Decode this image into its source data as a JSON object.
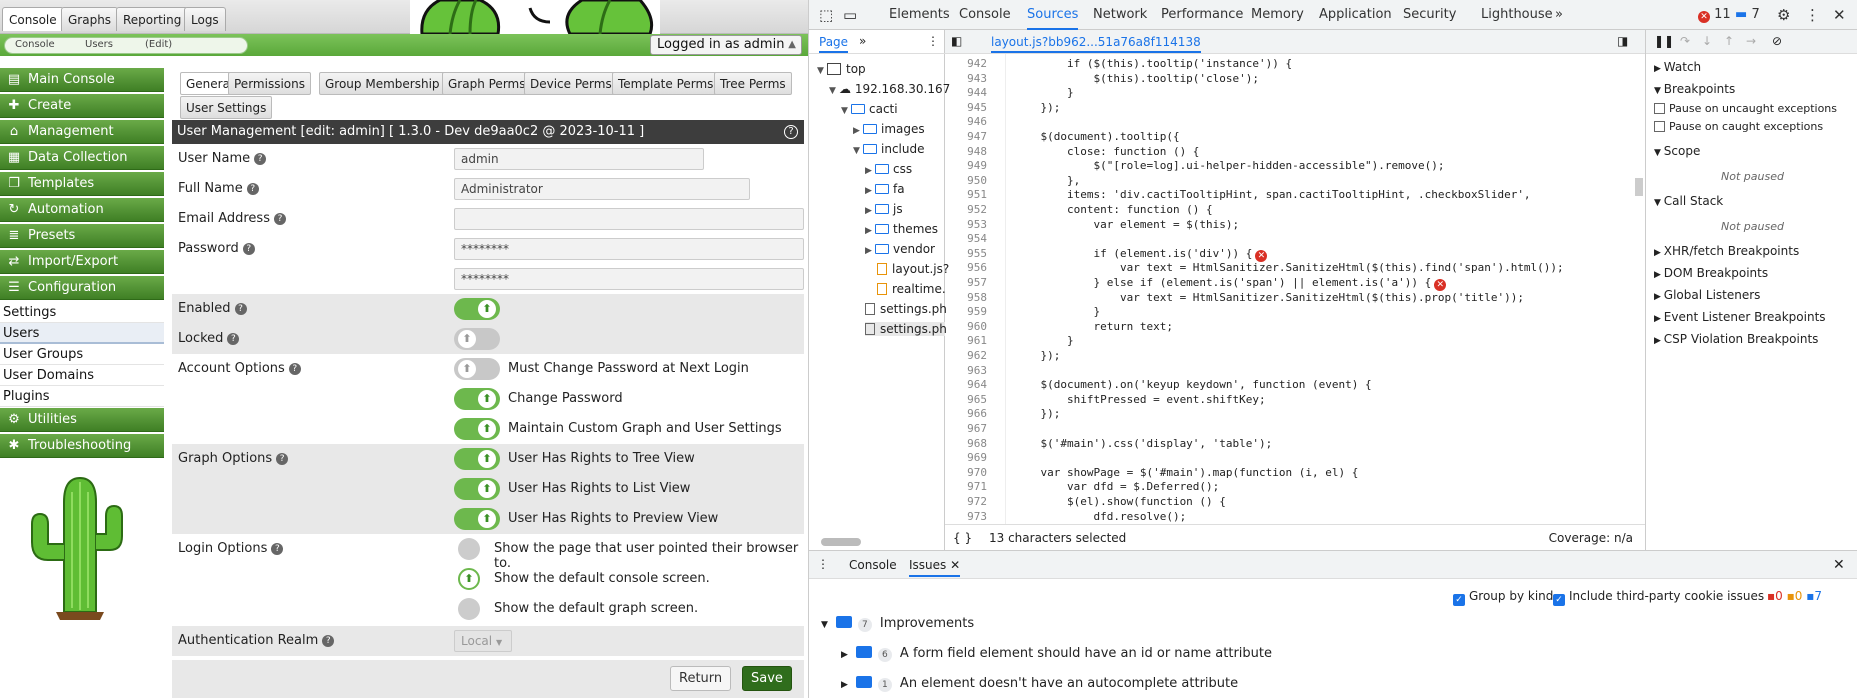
{
  "top_tabs": [
    "Console",
    "Graphs",
    "Reporting",
    "Logs"
  ],
  "breadcrumbs": [
    "Console",
    "Users",
    "(Edit)"
  ],
  "login_status": "Logged in as admin",
  "sidebar": {
    "menu": [
      {
        "label": "Main Console",
        "icon": "map-icon"
      },
      {
        "label": "Create",
        "icon": "plus-icon"
      },
      {
        "label": "Management",
        "icon": "home-icon"
      },
      {
        "label": "Data Collection",
        "icon": "database-icon"
      },
      {
        "label": "Templates",
        "icon": "clone-icon"
      },
      {
        "label": "Automation",
        "icon": "refresh-icon"
      },
      {
        "label": "Presets",
        "icon": "stack-icon"
      },
      {
        "label": "Import/Export",
        "icon": "exchange-icon"
      },
      {
        "label": "Configuration",
        "icon": "sliders-icon"
      }
    ],
    "sub_items": [
      "Settings",
      "Users",
      "User Groups",
      "User Domains",
      "Plugins"
    ],
    "menu_bottom": [
      {
        "label": "Utilities",
        "icon": "cogs-icon"
      },
      {
        "label": "Troubleshooting",
        "icon": "bug-icon"
      }
    ]
  },
  "subtabs_row1": [
    "General",
    "Permissions",
    "Group Membership",
    "Graph Perms",
    "Device Perms",
    "Template Perms",
    "Tree Perms"
  ],
  "subtabs_row2": [
    "User Settings"
  ],
  "form_title": "User Management [edit: admin] [ 1.3.0 - Dev de9aa0c2 @ 2023-10-11 ]",
  "fields": {
    "user_name": {
      "label": "User Name",
      "value": "admin"
    },
    "full_name": {
      "label": "Full Name",
      "value": "Administrator"
    },
    "email": {
      "label": "Email Address",
      "value": ""
    },
    "password": {
      "label": "Password",
      "value": "********",
      "confirm": "********"
    },
    "enabled": {
      "label": "Enabled"
    },
    "locked": {
      "label": "Locked"
    },
    "account_options": {
      "label": "Account Options",
      "options": [
        "Must Change Password at Next Login",
        "Change Password",
        "Maintain Custom Graph and User Settings"
      ]
    },
    "graph_options": {
      "label": "Graph Options",
      "options": [
        "User Has Rights to Tree View",
        "User Has Rights to List View",
        "User Has Rights to Preview View"
      ]
    },
    "login_options": {
      "label": "Login Options",
      "options": [
        "Show the page that user pointed their browser to.",
        "Show the default console screen.",
        "Show the default graph screen."
      ]
    },
    "auth_realm": {
      "label": "Authentication Realm",
      "value": "Local"
    }
  },
  "buttons": {
    "return": "Return",
    "save": "Save"
  },
  "devtools": {
    "tabs": [
      "Elements",
      "Console",
      "Sources",
      "Network",
      "Performance",
      "Memory",
      "Application",
      "Security",
      "Lighthouse"
    ],
    "error_count": "11",
    "message_count": "7",
    "nav_tabs": [
      "Page"
    ],
    "tree": [
      "top",
      "192.168.30.167",
      "cacti",
      "images",
      "include",
      "css",
      "fa",
      "js",
      "themes",
      "vendor",
      "layout.js?",
      "realtime.",
      "settings.ph",
      "settings.ph"
    ],
    "file_tab": "layout.js?bb962...51a76a8f114138",
    "line_numbers": [
      "942",
      "943",
      "944",
      "945",
      "946",
      "947",
      "948",
      "949",
      "950",
      "951",
      "952",
      "953",
      "954",
      "955",
      "956",
      "957",
      "958",
      "959",
      "960",
      "961",
      "962",
      "963",
      "964",
      "965",
      "966",
      "967",
      "968",
      "969",
      "970",
      "971",
      "972",
      "973"
    ],
    "code_lines": [
      "        if ($(this).tooltip('instance')) {",
      "            $(this).tooltip('close');",
      "        }",
      "    });",
      "",
      "    $(document).tooltip({",
      "        close: function () {",
      "            $(\"[role=log].ui-helper-hidden-accessible\").remove();",
      "        },",
      "        items: 'div.cactiTooltipHint, span.cactiTooltipHint, .checkboxSlider',",
      "        content: function () {",
      "            var element = $(this);",
      "",
      "            if (element.is('div')) {",
      "                var text = HtmlSanitizer.SanitizeHtml($(this).find('span').html());",
      "            } else if (element.is('span') || element.is('a')) {",
      "                var text = HtmlSanitizer.SanitizeHtml($(this).prop('title'));",
      "            }",
      "            return text;",
      "        }",
      "    });",
      "",
      "    $(document).on('keyup keydown', function (event) {",
      "        shiftPressed = event.shiftKey;",
      "    });",
      "",
      "    $('#main').css('display', 'table');",
      "",
      "    var showPage = $('#main').map(function (i, el) {",
      "        var dfd = $.Deferred();",
      "        $(el).show(function () {",
      "            dfd.resolve();",
      "        });"
    ],
    "selection_status": "13 characters selected",
    "coverage": "Coverage: n/a",
    "debugger": {
      "watch": "Watch",
      "breakpoints": "Breakpoints",
      "pause_uncaught": "Pause on uncaught exceptions",
      "pause_caught": "Pause on caught exceptions",
      "scope": "Scope",
      "not_paused": "Not paused",
      "call_stack": "Call Stack",
      "not_paused2": "Not paused",
      "sections": [
        "XHR/fetch Breakpoints",
        "DOM Breakpoints",
        "Global Listeners",
        "Event Listener Breakpoints",
        "CSP Violation Breakpoints"
      ]
    },
    "drawer": {
      "tabs": [
        "Console",
        "Issues"
      ],
      "group_by_kind": "Group by kind",
      "third_party": "Include third-party cookie issues",
      "counts": [
        "0",
        "0",
        "7"
      ],
      "category": "Improvements",
      "category_count": "7",
      "issues": [
        {
          "count": "6",
          "text": "A form field element should have an id or name attribute"
        },
        {
          "count": "1",
          "text": "An element doesn't have an autocomplete attribute"
        }
      ]
    }
  },
  "colors": {
    "cacti_green": "#4f9a33",
    "title_dark": "#3d3d3d",
    "devtools_blue": "#1a73e8",
    "error_red": "#d93025"
  }
}
